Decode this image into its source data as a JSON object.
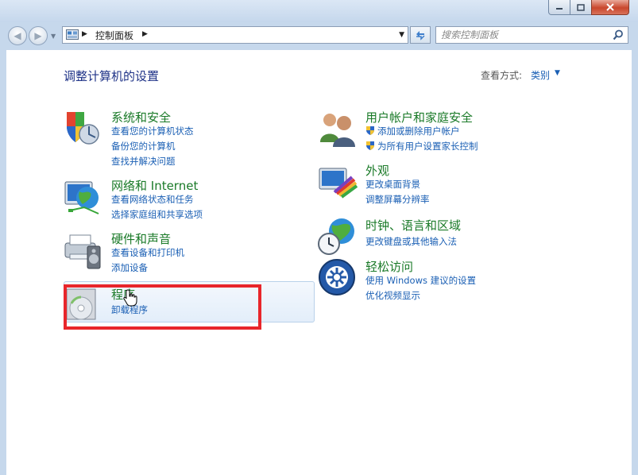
{
  "window": {
    "controls": [
      "minimize",
      "maximize",
      "close"
    ]
  },
  "address_bar": {
    "breadcrumb": "控制面板"
  },
  "search": {
    "placeholder": "搜索控制面板"
  },
  "header": {
    "title": "调整计算机的设置",
    "view_by_label": "查看方式:",
    "view_by_value": "类别"
  },
  "categories": [
    {
      "title": "系统和安全",
      "icon": "system-security-icon",
      "links": [
        "查看您的计算机状态",
        "备份您的计算机",
        "查找并解决问题"
      ]
    },
    {
      "title": "网络和 Internet",
      "icon": "network-internet-icon",
      "links": [
        "查看网络状态和任务",
        "选择家庭组和共享选项"
      ]
    },
    {
      "title": "硬件和声音",
      "icon": "hardware-sound-icon",
      "links": [
        "查看设备和打印机",
        "添加设备"
      ]
    },
    {
      "title": "程序",
      "icon": "programs-icon",
      "links": [
        "卸载程序"
      ]
    },
    {
      "title": "用户帐户和家庭安全",
      "icon": "user-accounts-icon",
      "links": [
        "添加或删除用户帐户",
        "为所有用户设置家长控制"
      ]
    },
    {
      "title": "外观",
      "icon": "appearance-icon",
      "links": [
        "更改桌面背景",
        "调整屏幕分辨率"
      ]
    },
    {
      "title": "时钟、语言和区域",
      "icon": "clock-language-icon",
      "links": [
        "更改键盘或其他输入法"
      ]
    },
    {
      "title": "轻松访问",
      "icon": "ease-of-access-icon",
      "links": [
        "使用 Windows 建议的设置",
        "优化视频显示"
      ]
    }
  ],
  "colors": {
    "category_title": "#1a7a28",
    "link": "#1a5fb4",
    "highlight_box": "#e8262b",
    "frame": "#c6d8ec"
  }
}
